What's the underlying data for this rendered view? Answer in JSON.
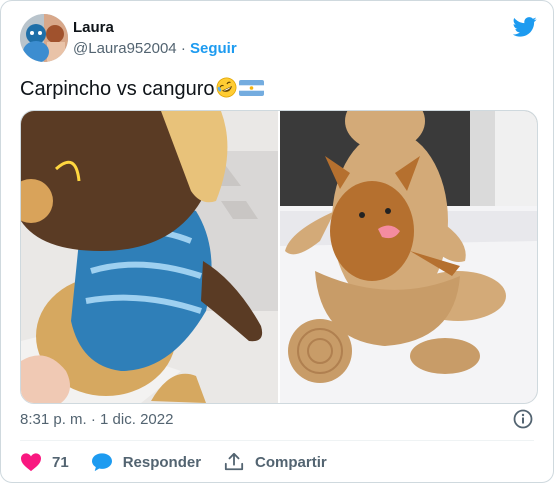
{
  "user": {
    "name": "Laura",
    "handle": "@Laura952004",
    "separator": "·",
    "follow_label": "Seguir"
  },
  "tweet": {
    "text": "Carpincho vs canguro"
  },
  "meta": {
    "time": "8:31 p. m.",
    "separator": "·",
    "date": "1 dic. 2022"
  },
  "actions": {
    "like_count": "71",
    "reply_label": "Responder",
    "share_label": "Compartir"
  },
  "icons": {
    "logo": "twitter-bird-icon",
    "emoji1": "rolling-on-floor-laughing-emoji",
    "emoji2": "argentina-flag-emoji",
    "info": "info-icon",
    "like": "heart-icon",
    "reply": "speech-bubble-icon",
    "share": "share-icon"
  },
  "colors": {
    "accent": "#1d9bf0",
    "like": "#f91880",
    "muted": "#536471"
  }
}
